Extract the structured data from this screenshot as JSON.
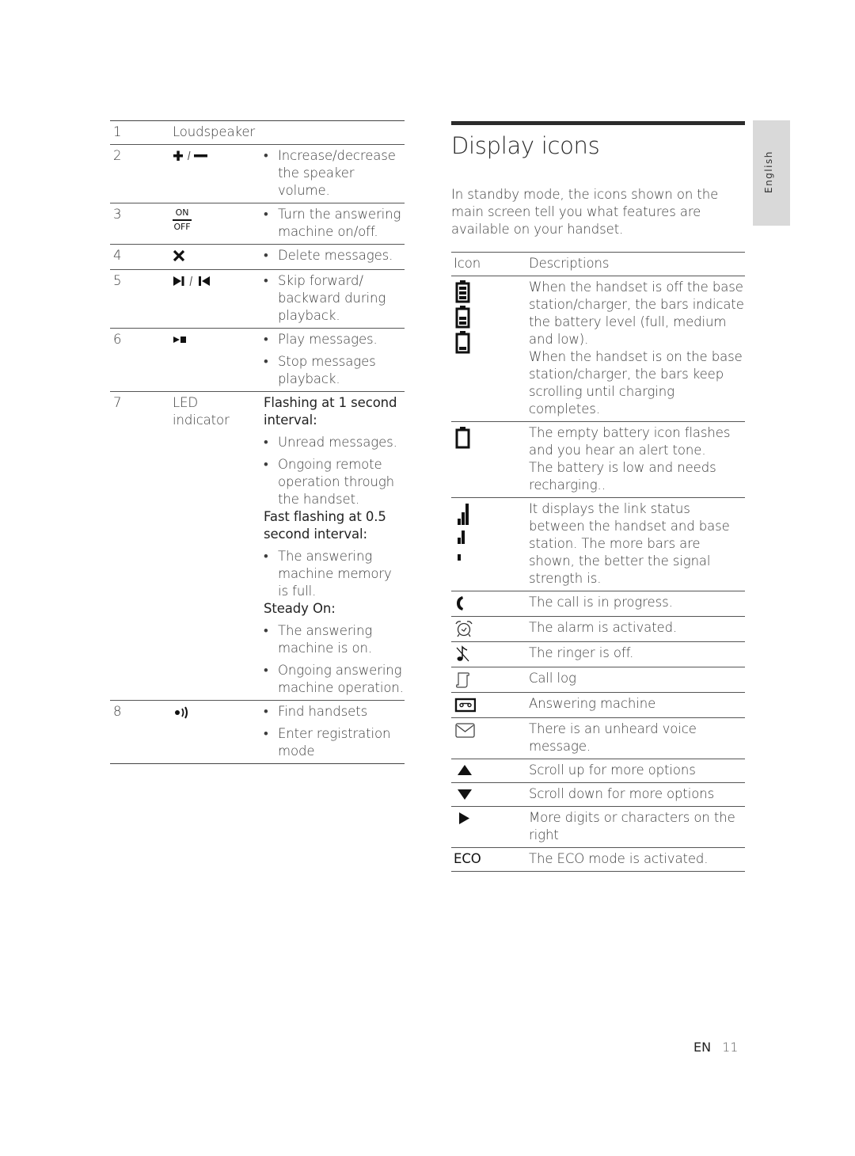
{
  "left_table": {
    "rows": [
      {
        "num": "1",
        "key_text": "Loudspeaker",
        "key_icon": null,
        "description": []
      },
      {
        "num": "2",
        "key_icon": "plus-minus-icon",
        "key_text": "",
        "description": [
          {
            "type": "bullet",
            "text": "Increase/decrease the speaker volume."
          }
        ]
      },
      {
        "num": "3",
        "key_icon": "on-off-icon",
        "key_text": "",
        "icon_labels": {
          "on": "ON",
          "off": "OFF"
        },
        "description": [
          {
            "type": "bullet",
            "text": "Turn the answering machine on/off."
          }
        ]
      },
      {
        "num": "4",
        "key_icon": "delete-x-icon",
        "key_text": "",
        "description": [
          {
            "type": "bullet",
            "text": "Delete messages."
          }
        ]
      },
      {
        "num": "5",
        "key_icon": "skip-forward-backward-icon",
        "key_text": "",
        "description": [
          {
            "type": "bullet",
            "text": "Skip forward/ backward during playback."
          }
        ]
      },
      {
        "num": "6",
        "key_icon": "play-stop-icon",
        "key_text": "",
        "description": [
          {
            "type": "bullet",
            "text": "Play messages."
          },
          {
            "type": "bullet",
            "text": "Stop messages playback."
          }
        ]
      },
      {
        "num": "7",
        "key_text": "LED indicator",
        "key_icon": null,
        "description": [
          {
            "type": "heading",
            "text": "Flashing at 1 second interval:"
          },
          {
            "type": "bullet",
            "text": "Unread messages."
          },
          {
            "type": "bullet",
            "text": "Ongoing remote operation through the handset."
          },
          {
            "type": "heading",
            "text": "Fast flashing at 0.5 second interval:"
          },
          {
            "type": "bullet",
            "text": "The answering machine memory is full."
          },
          {
            "type": "heading",
            "text": "Steady On:"
          },
          {
            "type": "bullet",
            "text": "The answering machine is on."
          },
          {
            "type": "bullet",
            "text": "Ongoing answering machine operation."
          }
        ]
      },
      {
        "num": "8",
        "key_icon": "find-handset-icon",
        "key_text": "",
        "description": [
          {
            "type": "bullet",
            "text": "Find handsets"
          },
          {
            "type": "bullet",
            "text": "Enter registration mode"
          }
        ]
      }
    ],
    "bullet_char": "•",
    "slash": "/"
  },
  "display_icons": {
    "title": "Display icons",
    "intro": "In standby mode, the icons shown on the main screen tell you what features are available on your handset.",
    "header": {
      "icon": "Icon",
      "descriptions": "Descriptions"
    },
    "rows": [
      {
        "icon": "battery-levels-icon",
        "description": "When the handset is off the base station/charger, the bars indicate the battery level (full, medium and low). When the handset is on the base station/charger, the bars keep scrolling until charging completes.",
        "lines": [
          "When the handset is off the base station/charger, the bars indicate the battery level (full, medium and low).",
          "When the handset is on the base station/charger, the bars keep scrolling until charging completes."
        ]
      },
      {
        "icon": "battery-empty-icon",
        "lines": [
          "The empty battery icon flashes and you hear an alert tone.",
          "The battery is low and needs recharging.."
        ]
      },
      {
        "icon": "signal-strength-icon",
        "lines": [
          "It displays the link status between the handset and base station. The more bars are shown, the better the signal strength is."
        ]
      },
      {
        "icon": "call-in-progress-icon",
        "lines": [
          "The call is in progress."
        ]
      },
      {
        "icon": "alarm-clock-icon",
        "lines": [
          "The alarm is activated."
        ]
      },
      {
        "icon": "ringer-off-icon",
        "lines": [
          "The ringer is off."
        ]
      },
      {
        "icon": "call-log-icon",
        "lines": [
          "Call log"
        ]
      },
      {
        "icon": "answering-machine-icon",
        "lines": [
          "Answering machine"
        ]
      },
      {
        "icon": "voice-message-icon",
        "lines": [
          "There is an unheard voice message."
        ]
      },
      {
        "icon": "scroll-up-icon",
        "lines": [
          "Scroll up for more options"
        ]
      },
      {
        "icon": "scroll-down-icon",
        "lines": [
          "Scroll down for more options"
        ]
      },
      {
        "icon": "more-right-icon",
        "lines": [
          "More digits or characters on the right"
        ]
      },
      {
        "icon": "eco-icon",
        "icon_text": "ECO",
        "lines": [
          "The ECO mode is activated."
        ]
      }
    ]
  },
  "side_tab": {
    "language": "English"
  },
  "footer": {
    "lang": "EN",
    "page": "11"
  }
}
